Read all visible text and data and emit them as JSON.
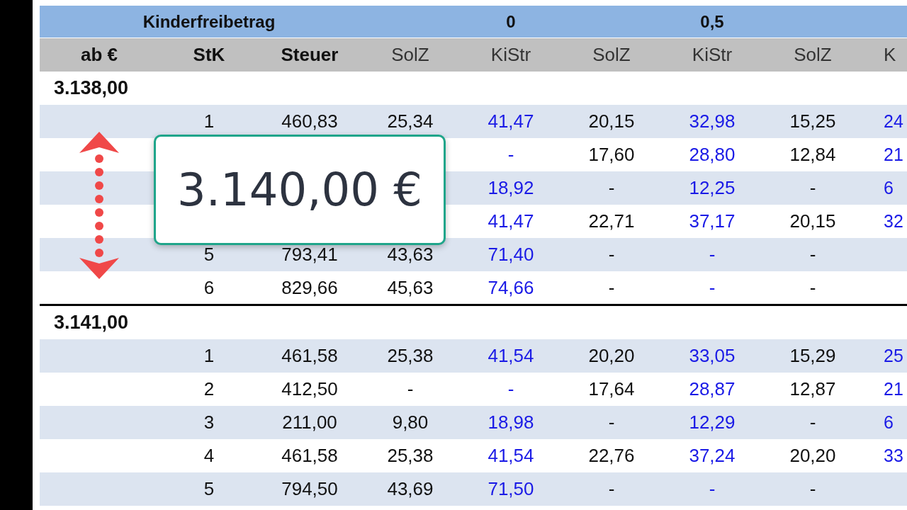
{
  "columns": [
    {
      "label": "ab €",
      "kind": "key"
    },
    {
      "label": "StK",
      "kind": "key",
      "group_header": "Kinderfreibetrag"
    },
    {
      "label": "Steuer",
      "kind": "key"
    },
    {
      "label": "SolZ",
      "kind": "plain"
    },
    {
      "label": "KiStr",
      "kind": "church",
      "group_header": "0"
    },
    {
      "label": "SolZ",
      "kind": "plain"
    },
    {
      "label": "KiStr",
      "kind": "church",
      "group_header": "0,5"
    },
    {
      "label": "SolZ",
      "kind": "plain"
    },
    {
      "label": "K",
      "kind": "church"
    }
  ],
  "groups": [
    {
      "label": "3.138,00",
      "rows": [
        [
          "1",
          "460,83",
          "25,34",
          "41,47",
          "20,15",
          "32,98",
          "15,25",
          "24"
        ],
        [
          null,
          null,
          null,
          "-",
          "17,60",
          "28,80",
          "12,84",
          "21"
        ],
        [
          null,
          null,
          null,
          "18,92",
          "-",
          "12,25",
          "-",
          "6"
        ],
        [
          null,
          null,
          null,
          "41,47",
          "22,71",
          "37,17",
          "20,15",
          "32"
        ],
        [
          "5",
          "793,41",
          "43,63",
          "71,40",
          "-",
          "-",
          "-",
          null
        ],
        [
          "6",
          "829,66",
          "45,63",
          "74,66",
          "-",
          "-",
          "-",
          null
        ]
      ]
    },
    {
      "label": "3.141,00",
      "rows": [
        [
          "1",
          "461,58",
          "25,38",
          "41,54",
          "20,20",
          "33,05",
          "15,29",
          "25"
        ],
        [
          "2",
          "412,50",
          "-",
          "-",
          "17,64",
          "28,87",
          "12,87",
          "21"
        ],
        [
          "3",
          "211,00",
          "9,80",
          "18,98",
          "-",
          "12,29",
          "-",
          "6"
        ],
        [
          "4",
          "461,58",
          "25,38",
          "41,54",
          "22,76",
          "37,24",
          "20,20",
          "33"
        ],
        [
          "5",
          "794,50",
          "43,69",
          "71,50",
          "-",
          "-",
          "-",
          null
        ]
      ]
    }
  ],
  "overlay": {
    "amount": "3.140,00 €"
  }
}
